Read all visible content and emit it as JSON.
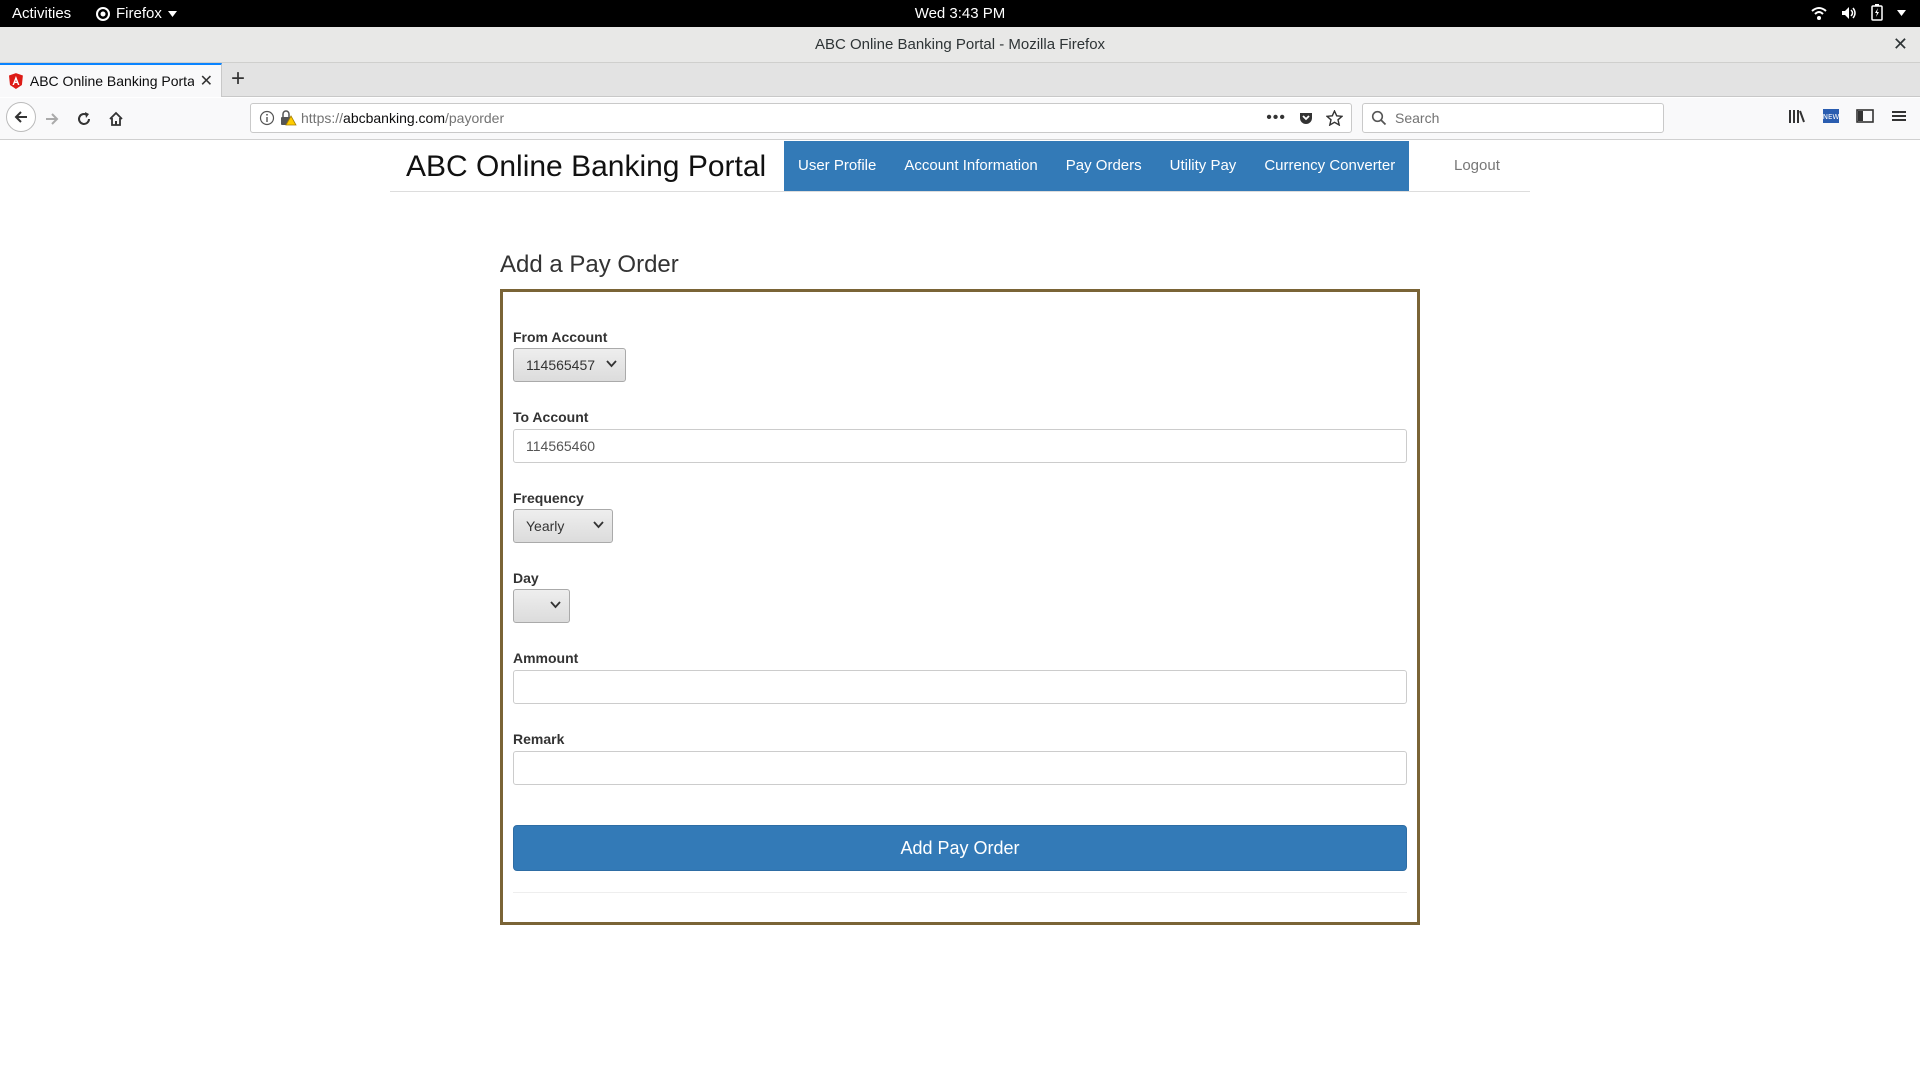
{
  "system_bar": {
    "activities": "Activities",
    "app_name": "Firefox",
    "clock": "Wed  3:43 PM"
  },
  "window": {
    "title": "ABC Online Banking Portal - Mozilla Firefox"
  },
  "browser": {
    "tab_title": "ABC Online Banking Portal",
    "url_prefix": "https://",
    "url_domain": "abcbanking.com",
    "url_path": "/payorder",
    "search_placeholder": "Search"
  },
  "site": {
    "brand": "ABC Online Banking Portal",
    "nav": [
      "User Profile",
      "Account Information",
      "Pay Orders",
      "Utility Pay",
      "Currency Converter"
    ],
    "logout": "Logout"
  },
  "form": {
    "title": "Add a Pay Order",
    "from_account": {
      "label": "From Account",
      "value": "114565457"
    },
    "to_account": {
      "label": "To Account",
      "value": "114565460"
    },
    "frequency": {
      "label": "Frequency",
      "value": "Yearly"
    },
    "day": {
      "label": "Day",
      "value": ""
    },
    "amount": {
      "label": "Ammount",
      "value": ""
    },
    "remark": {
      "label": "Remark",
      "value": ""
    },
    "submit_label": "Add Pay Order"
  },
  "colors": {
    "nav_bg": "#337ab7",
    "button_bg": "#337ab7",
    "form_border": "#7a6436",
    "tab_accent": "#0a84ff"
  }
}
